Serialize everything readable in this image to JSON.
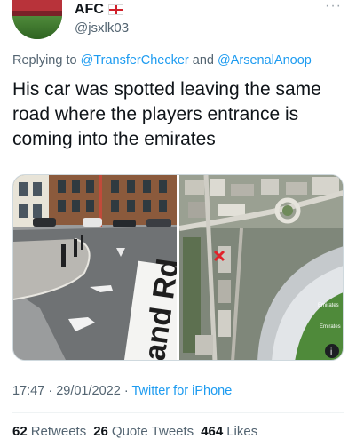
{
  "tweet": {
    "author": {
      "display_name": "AFC",
      "handle": "@jsxlk03",
      "flag_icon": "england-flag-icon",
      "avatar_icon": "stadium-avatar"
    },
    "reply": {
      "prefix": "Replying to",
      "mention_1": "@TransferChecker",
      "conjunction": "and",
      "mention_2": "@ArsenalAnoop"
    },
    "text": "His car was spotted leaving the same road where the players entrance is coming into the emirates",
    "media": {
      "left_image": {
        "street_sign_text": "and Rd"
      },
      "right_image": {
        "stadium_label_1": "Emirates",
        "stadium_label_2": "Emirates"
      }
    },
    "meta": {
      "time": "17:47",
      "separator": "·",
      "date": "29/01/2022",
      "source": "Twitter for iPhone"
    },
    "stats": {
      "retweets_count": "62",
      "retweets_label": "Retweets",
      "quotes_count": "26",
      "quotes_label": "Quote Tweets",
      "likes_count": "464",
      "likes_label": "Likes"
    },
    "colors": {
      "link": "#1d9bf0",
      "secondary_text": "#536471",
      "primary_text": "#0f1419"
    }
  }
}
